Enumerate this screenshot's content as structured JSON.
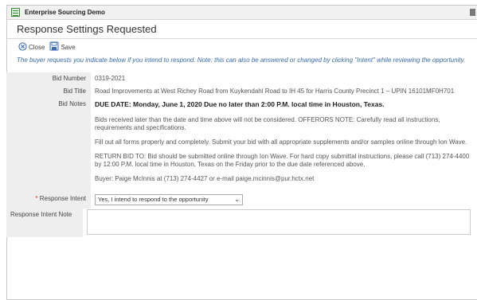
{
  "window": {
    "title": "Enterprise Sourcing Demo"
  },
  "page": {
    "title": "Response Settings Requested"
  },
  "toolbar": {
    "close_label": "Close",
    "save_label": "Save"
  },
  "note": "The buyer requests you indicate below if you intend to respond. Note: this can also be answered or changed by clicking \"Intent\" while reviewing the opportunity.",
  "fields": {
    "bid_number": {
      "label": "Bid Number",
      "value": "0319-2021"
    },
    "bid_title": {
      "label": "Bid Title",
      "value": "Road Improvements at West Richey Road from Kuykendahl Road to IH 45 for Harris County Precinct 1 – UPIN 16101MF0H701"
    },
    "bid_notes": {
      "label": "Bid Notes",
      "due_date": "DUE DATE: Monday, June 1, 2020 Due no later than 2:00 P.M. local time in Houston, Texas.",
      "paragraphs": [
        "Bids received later than the date and time above will not be considered. OFFERORS NOTE: Carefully read all instructions, requirements and specifications.",
        "Fill out all forms properly and completely. Submit your bid with all appropriate supplements and/or samples online through Ion Wave.",
        "RETURN BID TO: Bid should be submitted online through Ion Wave. For hard copy submittal instructions, please call (713) 274-4400 by 12:00 P.M. local time in Houston, Texas on the Friday prior to the due date referenced above.",
        "Buyer: Paige McInnis at (713) 274-4427 or e-mail paige.mcinnis@pur.hctx.net"
      ]
    },
    "response_intent": {
      "required_mark": "*",
      "label": "Response Intent",
      "value": "Yes, I intend to respond to the opportunity"
    },
    "response_intent_note": {
      "label": "Response Intent Note",
      "value": ""
    }
  }
}
